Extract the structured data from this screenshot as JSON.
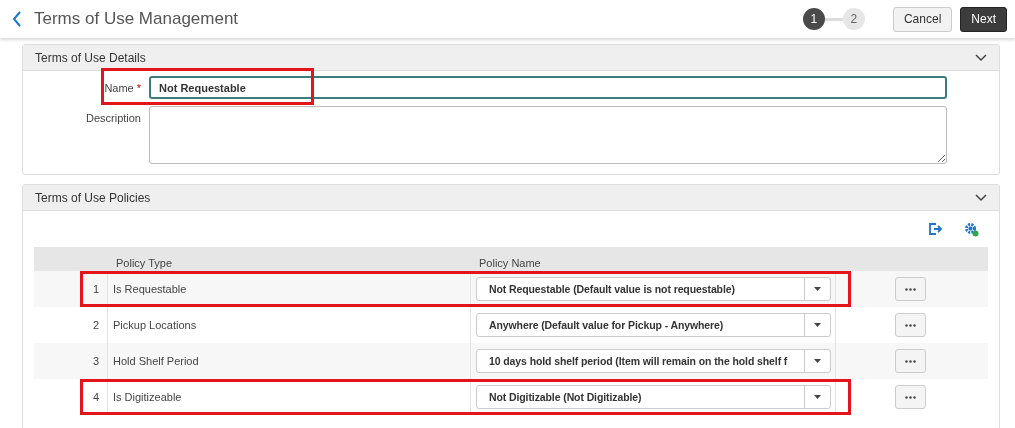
{
  "header": {
    "title": "Terms of Use Management",
    "steps": [
      {
        "label": "1",
        "selected": true
      },
      {
        "label": "2",
        "selected": false
      }
    ],
    "buttons": [
      {
        "label": "Cancel",
        "kind": "secondary"
      },
      {
        "label": "Next",
        "kind": "primary"
      }
    ]
  },
  "details": {
    "title": "Terms of Use Details",
    "name": {
      "label": "Name",
      "required_mark": "*",
      "value": "Not Requestable",
      "highlighted": true
    },
    "description": {
      "label": "Description"
    }
  },
  "policies": {
    "title": "Terms of Use Policies",
    "columns": [
      "Policy Type",
      "Policy Name"
    ],
    "rows": [
      {
        "number": "1",
        "policy_type": "Is Requestable",
        "policy_name": "Not Requestable (Default value is not requestable)",
        "highlighted": true
      },
      {
        "number": "2",
        "policy_type": "Pickup Locations",
        "policy_name": "Anywhere (Default value for Pickup - Anywhere)",
        "highlighted": false
      },
      {
        "number": "3",
        "policy_type": "Hold Shelf Period",
        "policy_name": "10 days hold shelf period (Item will remain on the hold shelf f",
        "highlighted": false
      },
      {
        "number": "4",
        "policy_type": "Is Digitizeable",
        "policy_name": "Not Digitizable (Not Digitizable)",
        "highlighted": true
      }
    ]
  }
}
